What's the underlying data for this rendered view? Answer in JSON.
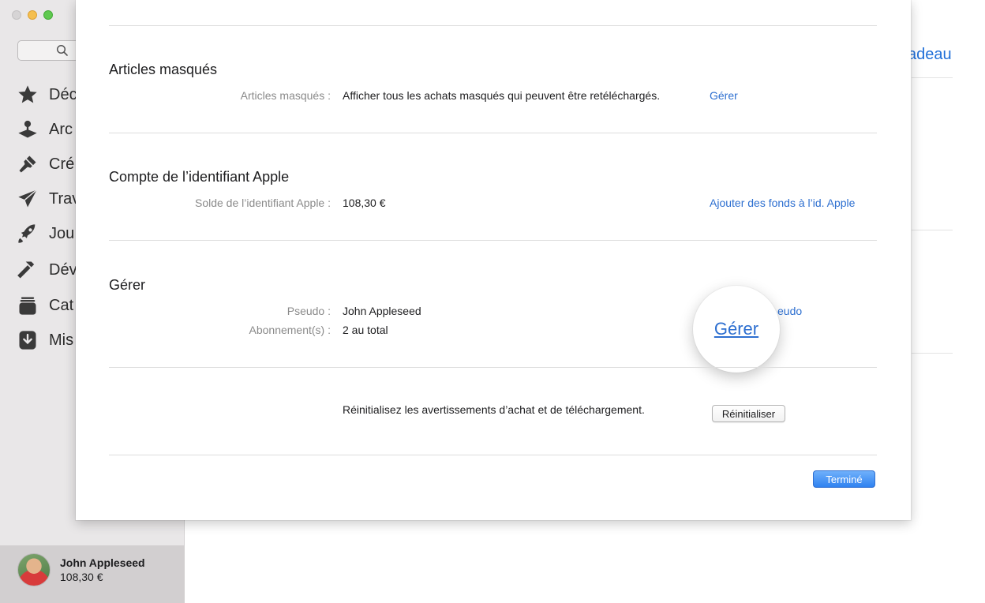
{
  "sidebar": {
    "items": [
      {
        "label": "Déc",
        "icon": "star-icon"
      },
      {
        "label": "Arc",
        "icon": "arcade-joystick-icon"
      },
      {
        "label": "Cré",
        "icon": "brush-icon"
      },
      {
        "label": "Trav",
        "icon": "paper-plane-icon"
      },
      {
        "label": "Jou",
        "icon": "rocket-icon"
      },
      {
        "label": "Dév",
        "icon": "hammer-icon"
      },
      {
        "label": "Cat",
        "icon": "stack-icon"
      },
      {
        "label": "Mis",
        "icon": "download-icon"
      }
    ],
    "account": {
      "name": "John Appleseed",
      "balance": "108,30 €"
    }
  },
  "background": {
    "link_fragment": "adeau"
  },
  "sheet": {
    "hidden": {
      "title": "Articles masqués",
      "label": "Articles masqués :",
      "value": "Afficher tous les achats masqués qui peuvent être retéléchargés.",
      "link": "Gérer"
    },
    "apple_id": {
      "title": "Compte de l’identifiant Apple",
      "label": "Solde de l’identifiant Apple :",
      "value": "108,30 €",
      "link": "Ajouter des fonds à l’id. Apple"
    },
    "manage": {
      "title": "Gérer",
      "nickname_label": "Pseudo :",
      "nickname_value": "John Appleseed",
      "nickname_link_fragment": "eudo",
      "subscriptions_label": "Abonnement(s) :",
      "subscriptions_value": "2 au total",
      "callout_link": "Gérer"
    },
    "reset": {
      "value": "Réinitialisez les avertissements d’achat et de téléchargement.",
      "button": "Réinitialiser"
    },
    "done_button": "Terminé"
  },
  "colors": {
    "link": "#2d6fd0",
    "done_button": "#2f82f0",
    "sidebar": "#e9e7e8"
  }
}
